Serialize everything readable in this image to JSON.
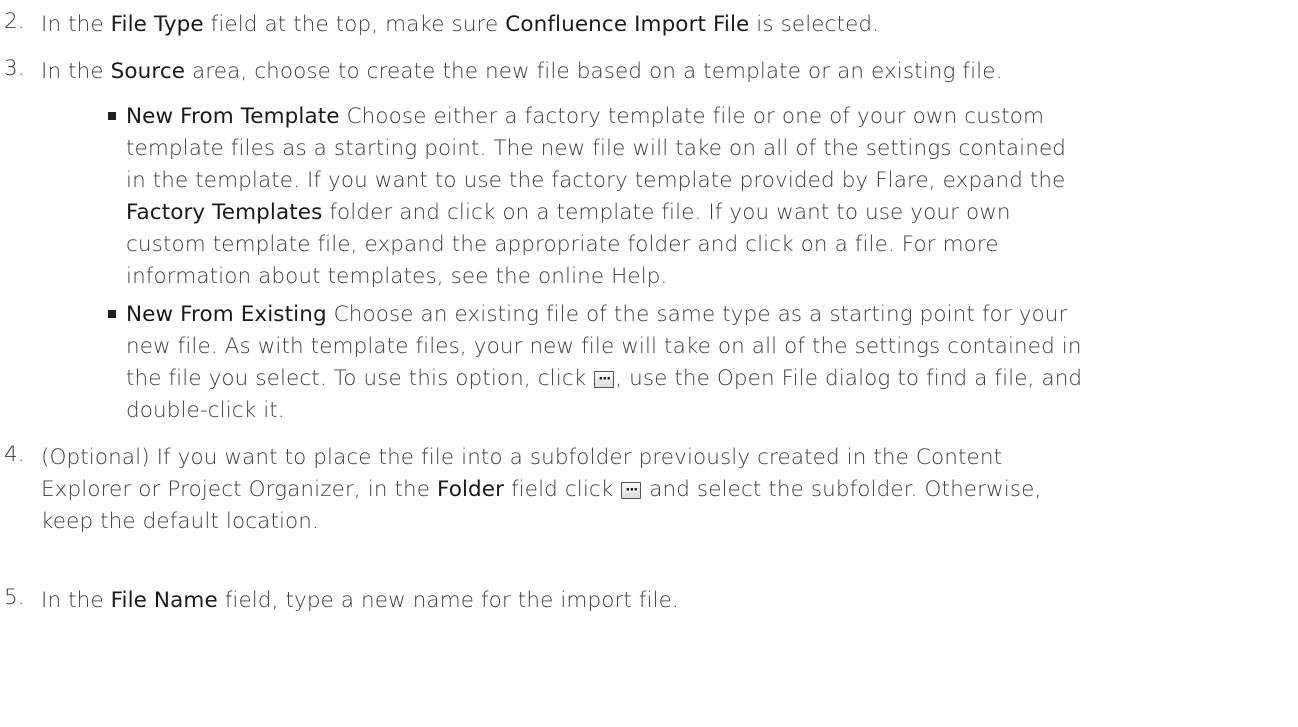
{
  "steps": [
    {
      "num": "2.",
      "lines": [
        [
          "In the ",
          {
            "b": "File Type"
          },
          " field at the top, make sure ",
          {
            "b": "Confluence Import File"
          },
          " is selected."
        ]
      ]
    },
    {
      "num": "3.",
      "lines": [
        [
          "In the ",
          {
            "b": "Source"
          },
          " area, choose to create the new file based on a template or an existing file."
        ]
      ],
      "subitems": [
        {
          "lines": [
            [
              {
                "b": "New From Template"
              },
              " Choose either a factory template file or one of your own custom"
            ],
            [
              "template files as a starting point. The new file will take on all of the settings contained"
            ],
            [
              "in the template. If you want to use the factory template provided by Flare, expand the"
            ],
            [
              {
                "b": "Factory Templates"
              },
              " folder and click on a template file. If you want to use your own"
            ],
            [
              "custom template file, expand the appropriate folder and click on a file. For more"
            ],
            [
              "information about templates, see the online Help."
            ]
          ]
        },
        {
          "lines": [
            [
              {
                "b": "New From Existing"
              },
              " Choose an existing file of the same type as a starting point for your"
            ],
            [
              "new file. As with template files, your new file will take on all of the settings contained in"
            ],
            [
              "the file you select. To use this option, click ",
              {
                "icon": "browse-button-icon"
              },
              ", use the Open File dialog to find a file, and"
            ],
            [
              "double-click it."
            ]
          ]
        }
      ]
    },
    {
      "num": "4.",
      "lines": [
        [
          "(Optional) If you want to place the file into a subfolder previously created in the Content"
        ],
        [
          "Explorer or Project Organizer, in the ",
          {
            "b": "Folder"
          },
          " field click ",
          {
            "icon": "browse-button-icon"
          },
          " and select the subfolder. Otherwise,"
        ],
        [
          "keep the default location."
        ]
      ]
    },
    {
      "num": "5.",
      "lines": [
        [
          "In the ",
          {
            "b": "File Name"
          },
          " field, type a new name for the import file."
        ]
      ]
    }
  ]
}
